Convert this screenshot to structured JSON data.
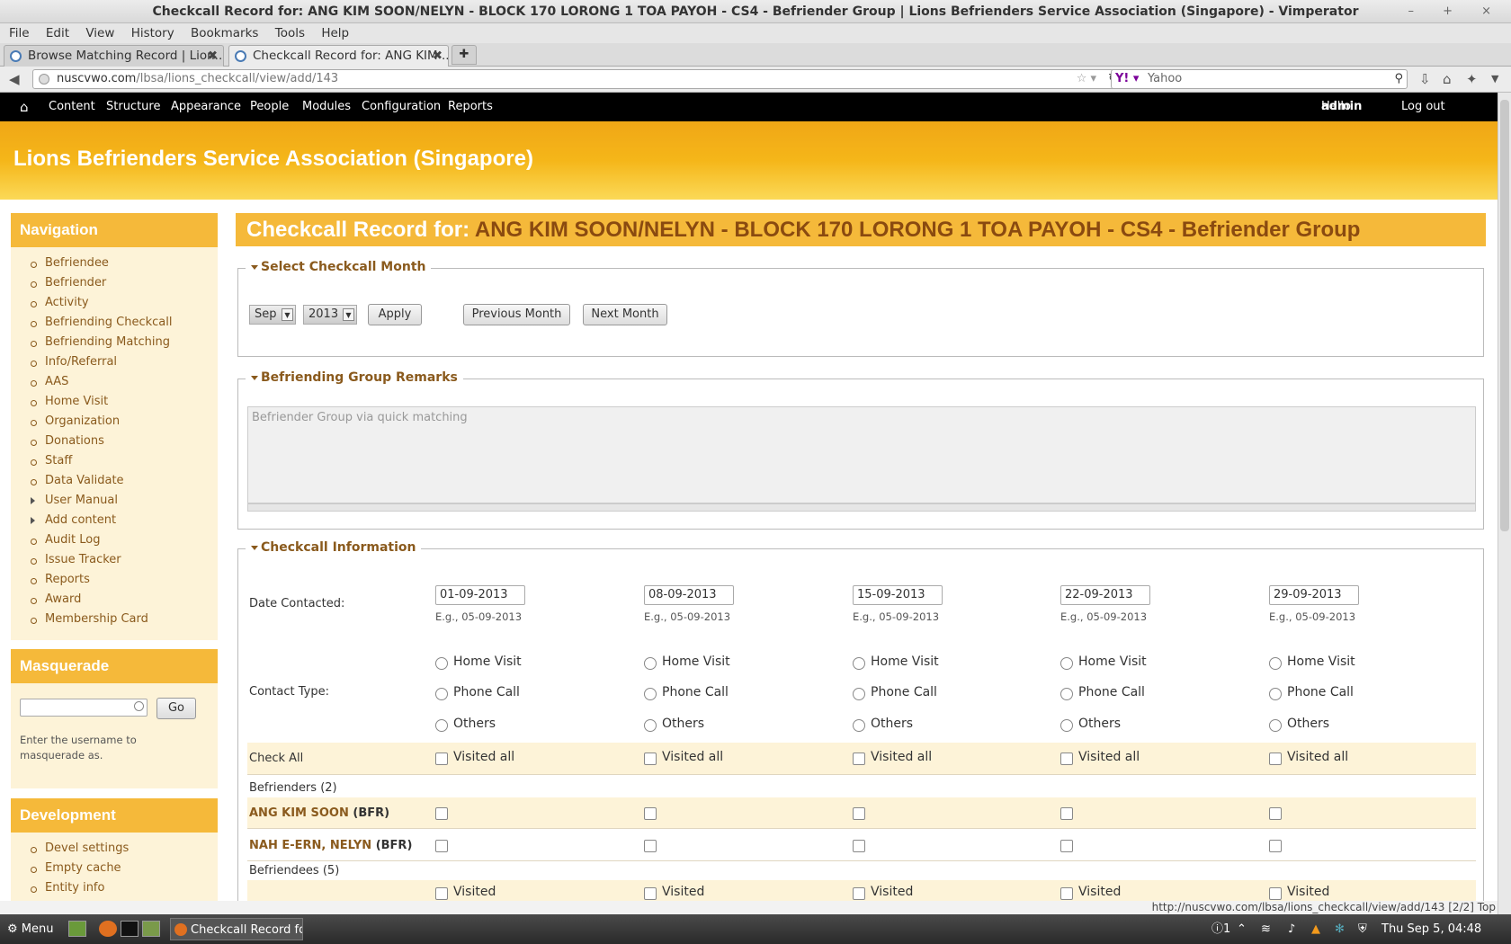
{
  "window": {
    "title": "Checkcall Record for: ANG KIM SOON/NELYN - BLOCK 170 LORONG 1 TOA PAYOH - CS4 - Befriender Group | Lions Befrienders Service Association (Singapore) - Vimperator",
    "controls": "– + ×"
  },
  "menu": [
    "File",
    "Edit",
    "View",
    "History",
    "Bookmarks",
    "Tools",
    "Help"
  ],
  "tabs": [
    {
      "label": "Browse Matching Record | Lion..."
    },
    {
      "label": "Checkcall Record for: ANG KIM ..."
    }
  ],
  "url": {
    "host": "nuscvwo.com",
    "path": "/lbsa/lions_checkcall/view/add/143"
  },
  "search": {
    "engine": "Yahoo"
  },
  "toolbar": {
    "items": [
      "Content",
      "Structure",
      "Appearance",
      "People",
      "Modules",
      "Configuration",
      "Reports"
    ],
    "hello": "Hello ",
    "user": "admin",
    "logout": "Log out"
  },
  "site": {
    "name": "Lions Befrienders Service Association (Singapore)"
  },
  "sidebar": {
    "nav_title": "Navigation",
    "nav": [
      "Befriendee",
      "Befriender",
      "Activity",
      "Befriending Checkcall",
      "Befriending Matching",
      "Info/Referral",
      "AAS",
      "Home Visit",
      "Organization",
      "Donations",
      "Staff",
      "Data Validate",
      "User Manual",
      "Add content",
      "Audit Log",
      "Issue Tracker",
      "Reports",
      "Award",
      "Membership Card"
    ],
    "masq_title": "Masquerade",
    "masq_go": "Go",
    "masq_hint": "Enter the username to masquerade as.",
    "dev_title": "Development",
    "dev": [
      "Devel settings",
      "Empty cache",
      "Entity info"
    ]
  },
  "page": {
    "title_prefix": "Checkcall Record for: ",
    "title_name": "ANG KIM SOON/NELYN - BLOCK 170 LORONG 1 TOA PAYOH - CS4 - Befriender Group"
  },
  "month": {
    "legend": "Select Checkcall Month",
    "month": "Sep",
    "year": "2013",
    "apply": "Apply",
    "prev": "Previous Month",
    "next": "Next Month"
  },
  "remarks": {
    "legend": "Befriending Group Remarks",
    "text": "Befriender Group via quick matching"
  },
  "info": {
    "legend": "Checkcall Information",
    "date_label": "Date Contacted:",
    "dates": [
      "01-09-2013",
      "08-09-2013",
      "15-09-2013",
      "22-09-2013",
      "29-09-2013"
    ],
    "hint": "E.g., 05-09-2013",
    "contact_label": "Contact Type:",
    "types": [
      "Home Visit",
      "Phone Call",
      "Others"
    ],
    "check_all": "Check All",
    "visited_all": "Visited all",
    "befrienders_label": "Befrienders",
    "befrienders_count": "(2)",
    "befrienders": [
      {
        "name": "ANG KIM SOON",
        "role": "(BFR)"
      },
      {
        "name": "NAH E-ERN, NELYN",
        "role": "(BFR)"
      }
    ],
    "befriendees_label": "Befriendees",
    "befriendees_count": "(5)",
    "visited": "Visited"
  },
  "status": {
    "text": "http://nuscvwo.com/lbsa/lions_checkcall/view/add/143 [2/2] Top"
  },
  "taskbar": {
    "menu": "Menu",
    "window": "Checkcall Record fo...",
    "notif": "1",
    "clock": "Thu Sep  5, 04:48"
  }
}
